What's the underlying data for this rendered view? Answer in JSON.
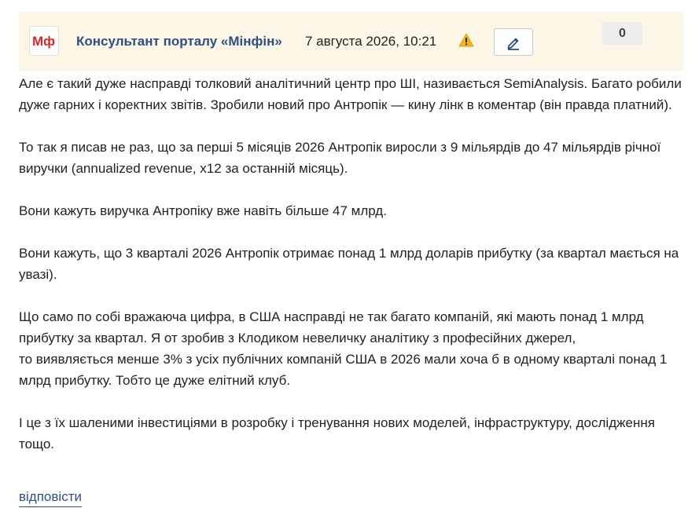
{
  "header": {
    "logo_text": "Мф",
    "author": "Консультант порталу «Мінфін»",
    "date": "7 августа 2026, 10:21",
    "warning_icon": "warning-triangle-icon",
    "edit_icon": "pencil-icon",
    "vote_count": "0"
  },
  "colors": {
    "header_bg": "#fbf6e6",
    "accent_blue": "#2d4f86",
    "logo_red": "#e0242b",
    "warning_yellow": "#f2b320"
  },
  "post": {
    "paragraphs": [
      "Але є такий дуже насправді толковий аналітичний центр про ШІ, називається SemiAnalysis. Багато робили дуже гарних і коректних звітів. Зробили новий про Антропік — кину лінк в коментар (він правда платний).",
      "То так я писав не раз, що за перші 5 місяців 2026 Антропік виросли з 9 мільярдів до 47 мільярдів річної виручки (annualized revenue, x12 за останній місяць).",
      "Вони кажуть виручка Антропіку вже навіть більше 47 млрд.",
      "Вони кажуть, що 3 кварталі 2026 Антропік отримає понад 1 млрд доларів прибутку (за квартал мається на увазі).",
      "Що само по собі вражаюча цифра, в США насправді не так багато компаній, які мають понад 1 млрд прибутку за квартал. Я от зробив з Клодиком невеличку аналітику з професійних джерел,",
      "І це з їх шаленими інвестиціями в розробку і тренування нових моделей, інфраструктуру, дослідження тощо."
    ],
    "paragraph5_line2": "то виявляється менше 3% з усіх публічних компаній США в 2026 мали хоча б в одному кварталі понад 1 млрд прибутку. Тобто це дуже елітний клуб."
  },
  "actions": {
    "reply_label": "відповісти"
  }
}
